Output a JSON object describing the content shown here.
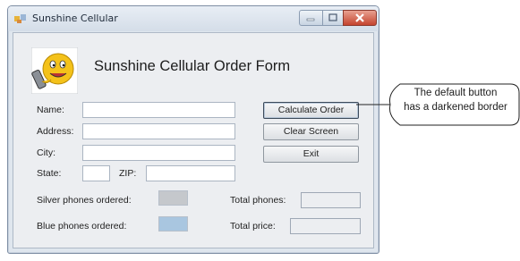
{
  "window": {
    "title": "Sunshine Cellular"
  },
  "form": {
    "heading": "Sunshine Cellular Order Form",
    "labels": {
      "name": "Name:",
      "address": "Address:",
      "city": "City:",
      "state": "State:",
      "zip": "ZIP:",
      "silver": "Silver phones ordered:",
      "blue": "Blue phones ordered:",
      "total_phones": "Total phones:",
      "total_price": "Total price:"
    },
    "buttons": {
      "calculate": "Calculate Order",
      "clear": "Clear Screen",
      "exit": "Exit"
    },
    "colors": {
      "silver_swatch": "#c5c8cc",
      "blue_swatch": "#a9c6e0"
    }
  },
  "callout": {
    "line1": "The default button",
    "line2": "has a darkened border"
  }
}
